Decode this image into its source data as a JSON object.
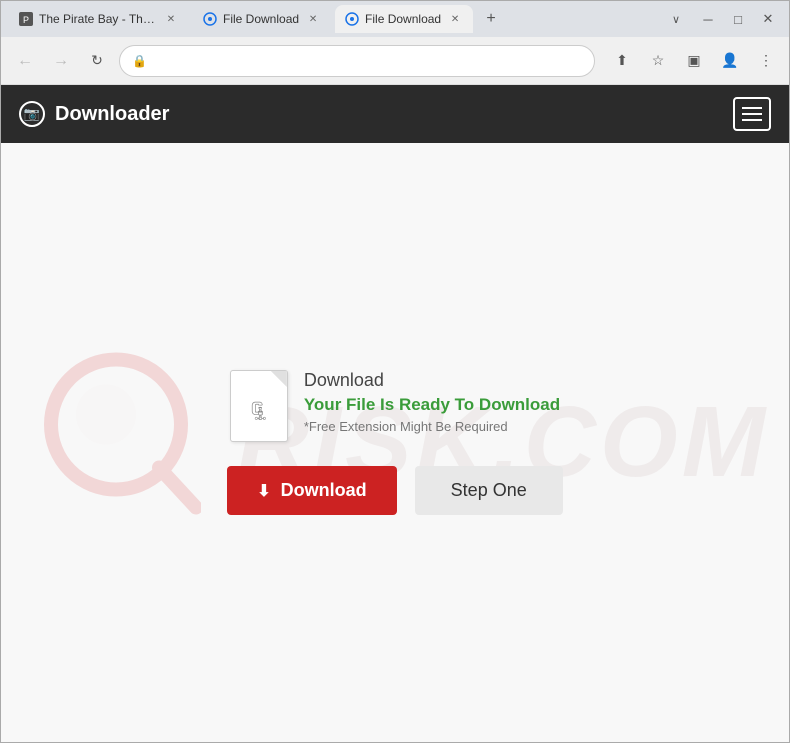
{
  "browser": {
    "tabs": [
      {
        "id": "tab-1",
        "title": "The Pirate Bay - The...",
        "icon": "pirate-icon",
        "active": false,
        "favicon_color": "#555"
      },
      {
        "id": "tab-2",
        "title": "File Download",
        "icon": "globe-icon",
        "active": false,
        "favicon_color": "#1a73e8"
      },
      {
        "id": "tab-3",
        "title": "File Download",
        "icon": "globe-icon",
        "active": true,
        "favicon_color": "#1a73e8"
      }
    ],
    "new_tab_label": "+",
    "window_controls": {
      "chevron_up": "∨",
      "minimize": "─",
      "maximize": "□",
      "close": "✕"
    },
    "nav": {
      "back": "←",
      "forward": "→",
      "refresh": "↻",
      "lock": "🔒"
    },
    "address_bar_actions": {
      "share": "⬆",
      "star": "☆",
      "sidebar": "▣",
      "profile": "👤",
      "menu": "⋮"
    }
  },
  "navbar": {
    "brand": "Downloader",
    "brand_icon": "📷",
    "toggle_label": "menu"
  },
  "main": {
    "download_label": "Download",
    "download_ready_text": "Your File Is Ready To Download",
    "download_note": "*Free Extension Might Be Required",
    "download_button_label": "Download",
    "step_one_button_label": "Step One",
    "watermark_text": "RISK.COM"
  }
}
